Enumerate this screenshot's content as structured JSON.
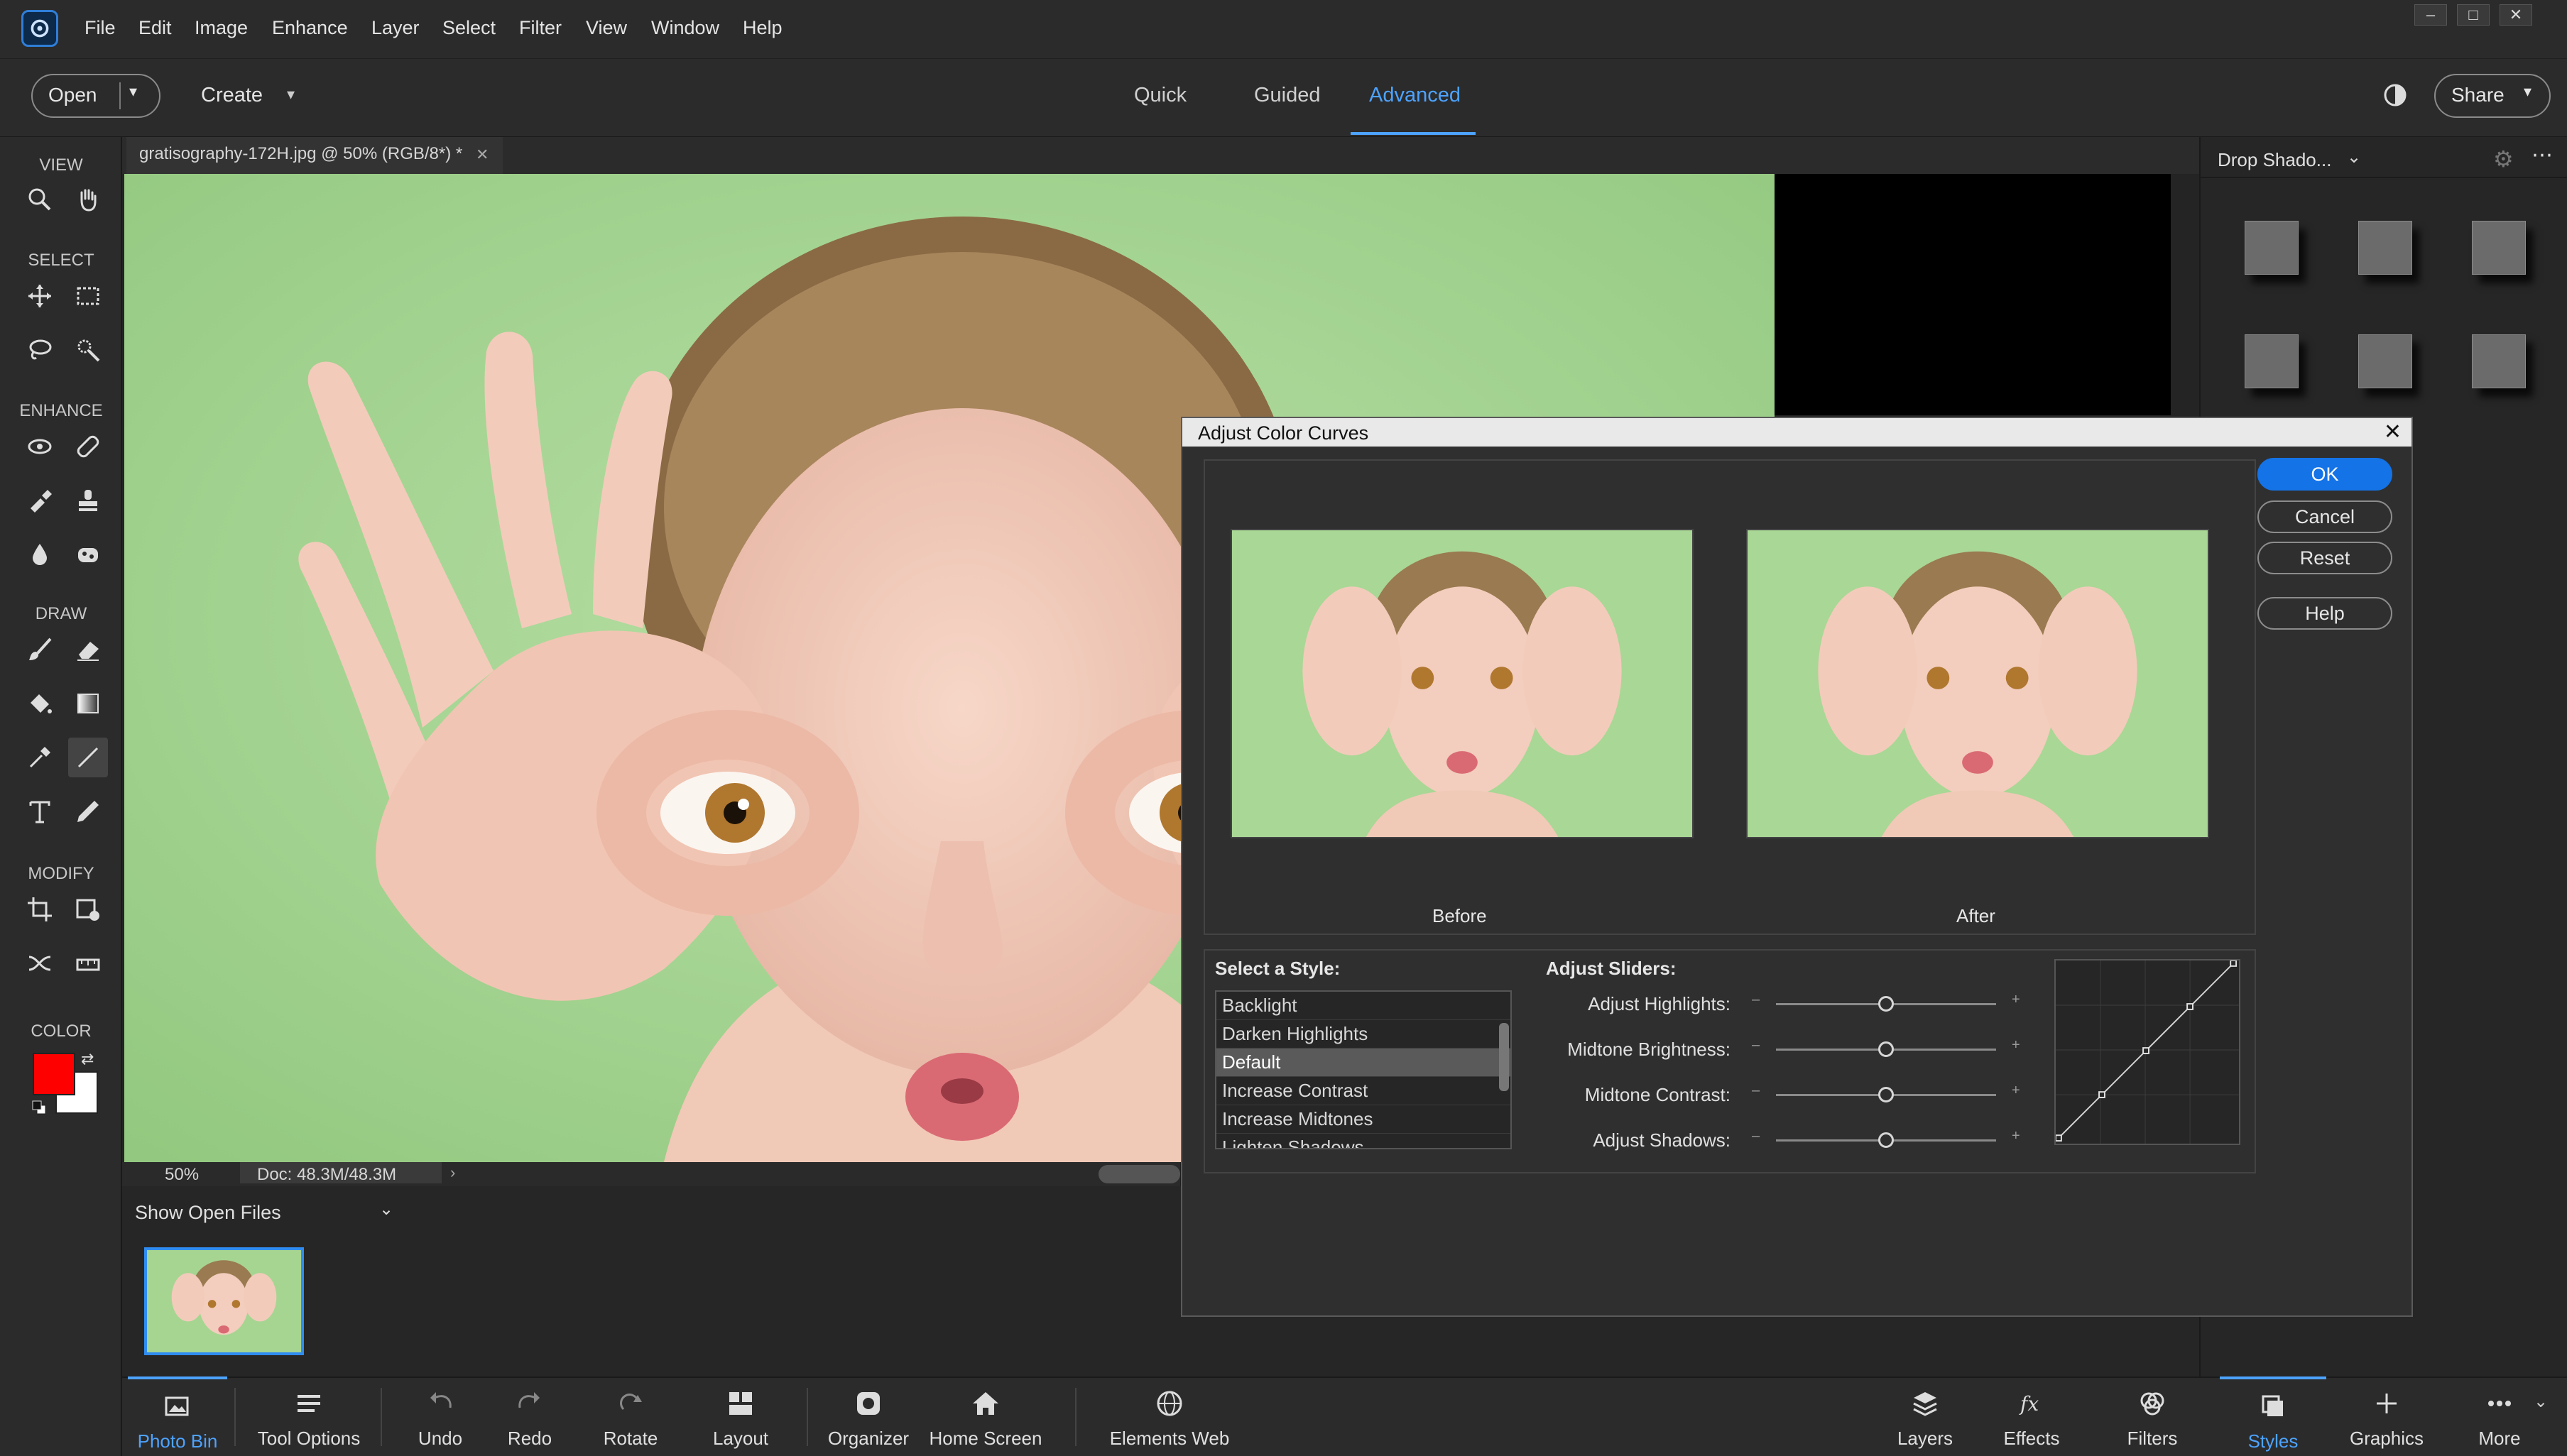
{
  "menubar": {
    "items": [
      "File",
      "Edit",
      "Image",
      "Enhance",
      "Layer",
      "Select",
      "Filter",
      "View",
      "Window",
      "Help"
    ]
  },
  "toolbar": {
    "open_label": "Open",
    "create_label": "Create",
    "modes": [
      "Quick",
      "Guided",
      "Advanced"
    ],
    "active_mode": "Advanced",
    "share_label": "Share"
  },
  "tools": {
    "sections": [
      "VIEW",
      "SELECT",
      "ENHANCE",
      "DRAW",
      "MODIFY",
      "COLOR"
    ],
    "foreground_color": "#ff0000",
    "background_color": "#ffffff"
  },
  "document": {
    "tab_title": "gratisography-172H.jpg @ 50% (RGB/8*) *",
    "zoom": "50%",
    "doc_size": "Doc: 48.3M/48.3M"
  },
  "photo_bin": {
    "dropdown_label": "Show Open Files"
  },
  "right_panel": {
    "dropdown_label": "Drop Shado..."
  },
  "dialog": {
    "title": "Adjust Color Curves",
    "ok": "OK",
    "cancel": "Cancel",
    "reset": "Reset",
    "help": "Help",
    "before_label": "Before",
    "after_label": "After",
    "select_style_label": "Select a Style:",
    "styles": [
      "Backlight",
      "Darken Highlights",
      "Default",
      "Increase Contrast",
      "Increase Midtones",
      "Lighten Shadows"
    ],
    "selected_style": "Default",
    "adjust_sliders_label": "Adjust Sliders:",
    "sliders": [
      {
        "label": "Adjust Highlights:",
        "value": 0.5
      },
      {
        "label": "Midtone Brightness:",
        "value": 0.5
      },
      {
        "label": "Midtone Contrast:",
        "value": 0.5
      },
      {
        "label": "Adjust Shadows:",
        "value": 0.5
      }
    ],
    "minus": "–",
    "plus": "+"
  },
  "bottombar": {
    "photo_bin": "Photo Bin",
    "tool_options": "Tool Options",
    "undo": "Undo",
    "redo": "Redo",
    "rotate": "Rotate",
    "layout": "Layout",
    "organizer": "Organizer",
    "home_screen": "Home Screen",
    "elements_web": "Elements Web",
    "layers": "Layers",
    "effects": "Effects",
    "filters": "Filters",
    "styles": "Styles",
    "graphics": "Graphics",
    "more": "More"
  },
  "colors": {
    "accent": "#4da3ff",
    "primary_button": "#1473e6",
    "photo_background": "#9fd18e"
  }
}
